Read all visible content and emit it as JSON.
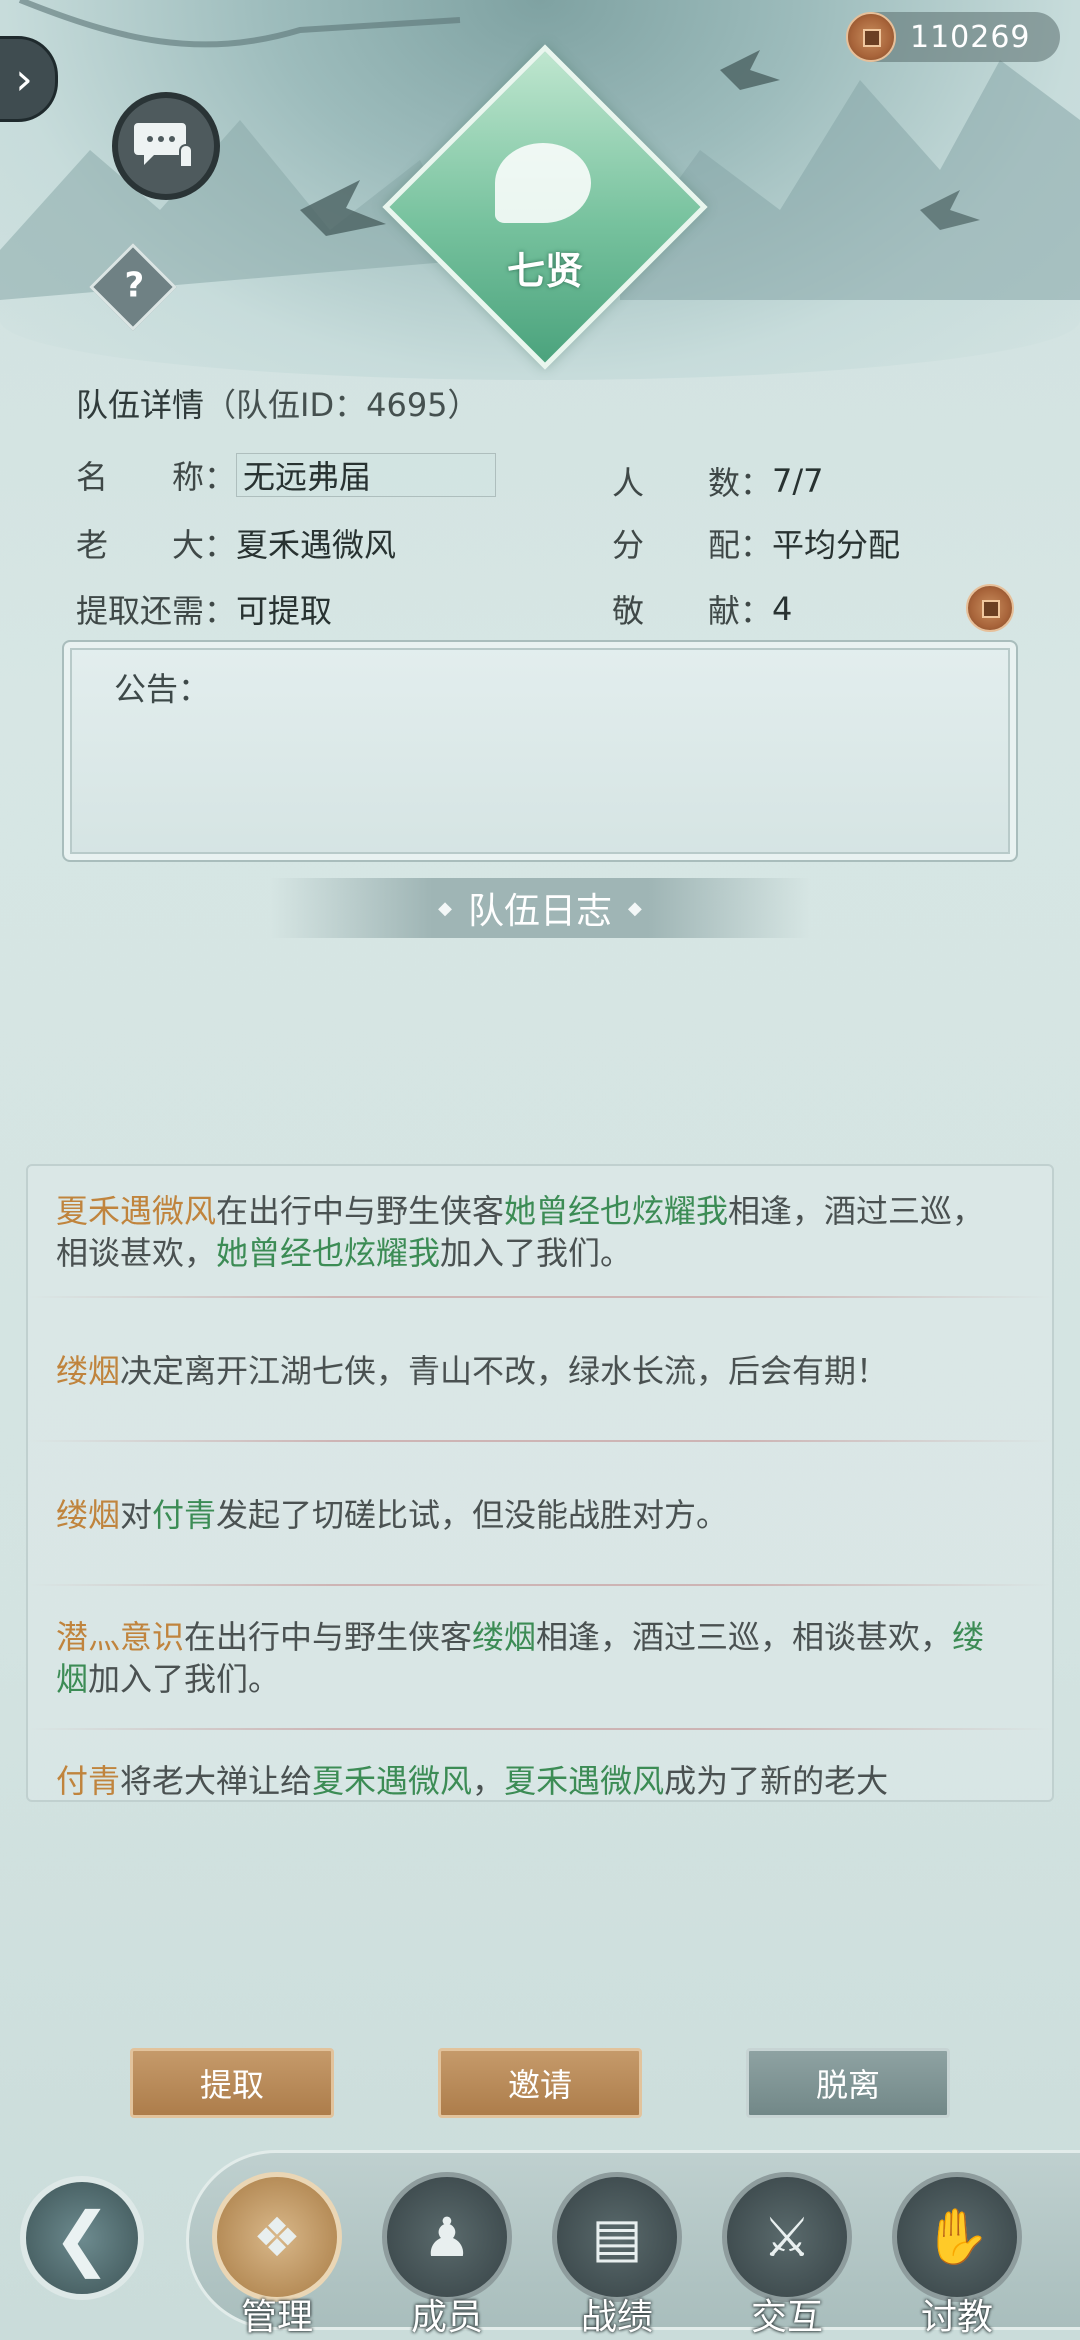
{
  "header": {
    "coins": "110269",
    "emblem_label": "七贤"
  },
  "team": {
    "title": "队伍详情",
    "id_text": "（队伍ID：4695）",
    "name_label": "名　　称：",
    "name_value": "无远弗届",
    "members_label": "人　　数：",
    "members_value": "7/7",
    "leader_label": "老　　大：",
    "leader_value": "夏禾遇微风",
    "distribution_label": "分　　配：",
    "distribution_value": "平均分配",
    "withdraw_label": "提取还需：",
    "withdraw_value": "可提取",
    "contribution_label": "敬　　献：",
    "contribution_value": "4",
    "notice_label": "公告："
  },
  "log": {
    "title": "队伍日志",
    "entries": [
      {
        "p1": "夏禾遇微风",
        "t1": "在出行中与野生侠客",
        "p2": "她曾经也炫耀我",
        "t2": "相逢，酒过三巡，相谈甚欢，",
        "p3": "她曾经也炫耀我",
        "t3": "加入了我们。"
      },
      {
        "p1": "缕烟",
        "t1": "决定离开江湖七侠，青山不改，绿水长流，后会有期！"
      },
      {
        "p1": "缕烟",
        "t1": "对",
        "p2": "付青",
        "t2": "发起了切磋比试，但没能战胜对方。"
      },
      {
        "p1": "潜灬意识",
        "t1": "在出行中与野生侠客",
        "p2": "缕烟",
        "t2": "相逢，酒过三巡，相谈甚欢，",
        "p3": "缕烟",
        "t3": "加入了我们。"
      },
      {
        "p1": "付青",
        "t1": "将老大禅让给",
        "p2": "夏禾遇微风",
        "t2": "，",
        "p3": "夏禾遇微风",
        "t3": "成为了新的老大"
      }
    ]
  },
  "actions": {
    "withdraw": "提取",
    "invite": "邀请",
    "leave": "脱离"
  },
  "nav": {
    "manage": "管理",
    "members": "成员",
    "records": "战绩",
    "interact": "交互",
    "tutor": "讨教"
  }
}
